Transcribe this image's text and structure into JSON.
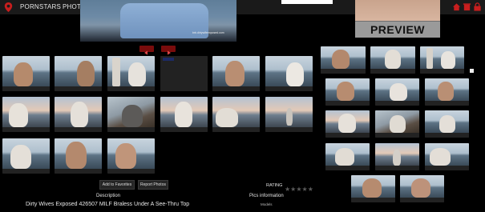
{
  "nav": {
    "pornstars": "PORNSTARS",
    "photos": "PHOTOS"
  },
  "preview": {
    "label": "PREVIEW"
  },
  "hero": {
    "watermark": "brb.dirtywifeexposed.com"
  },
  "icons": [
    "location-pin-icon",
    "home-icon",
    "trash-icon",
    "lock-icon",
    "arrow-left-icon",
    "arrow-right-icon",
    "star-icon"
  ],
  "colors": {
    "accent": "#c81e1e",
    "topbar": "#1a1a1a",
    "background": "#000000"
  },
  "actions": {
    "add_favorites": "Add to Favorites",
    "report_photos": "Report Photos"
  },
  "rating": {
    "label": "RATING",
    "stars": 5,
    "value": 0
  },
  "sections": {
    "description": "Description",
    "pics_information": "Pics information",
    "models": "Models"
  },
  "description": {
    "text": "Dirty Wives Exposed 426507 MILF Braless Under A See-Thru Top"
  }
}
